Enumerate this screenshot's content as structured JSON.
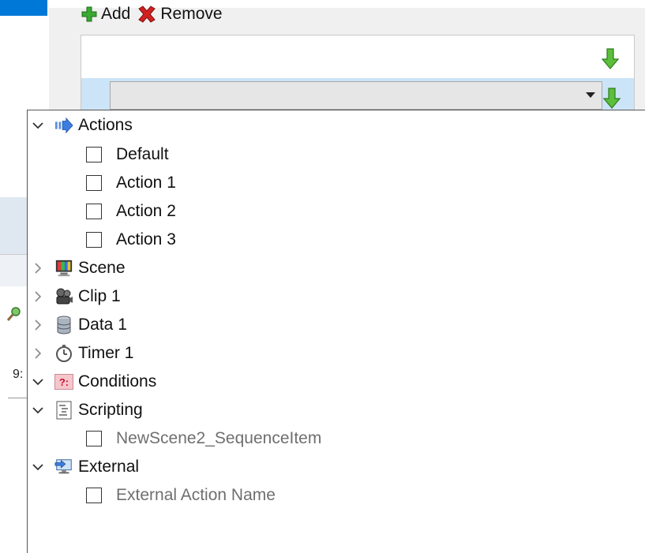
{
  "toolbar": {
    "add_label": "Add",
    "remove_label": "Remove"
  },
  "background": {
    "partial_text": "9:"
  },
  "tree": {
    "actions": {
      "label": "Actions",
      "children": [
        "Default",
        "Action 1",
        "Action 2",
        "Action 3"
      ]
    },
    "scene": {
      "label": "Scene"
    },
    "clip": {
      "label": "Clip 1"
    },
    "data": {
      "label": "Data 1"
    },
    "timer": {
      "label": "Timer 1"
    },
    "conditions": {
      "label": "Conditions",
      "icon_text": "?:"
    },
    "scripting": {
      "label": "Scripting",
      "children": [
        "NewScene2_SequenceItem"
      ]
    },
    "external": {
      "label": "External",
      "children": [
        "External Action Name"
      ]
    }
  },
  "colors": {
    "accent": "#0078d7",
    "selection": "#cce4f7",
    "add_green": "#3aa832",
    "remove_red": "#d32020",
    "muted_text": "#6f6f6f"
  }
}
